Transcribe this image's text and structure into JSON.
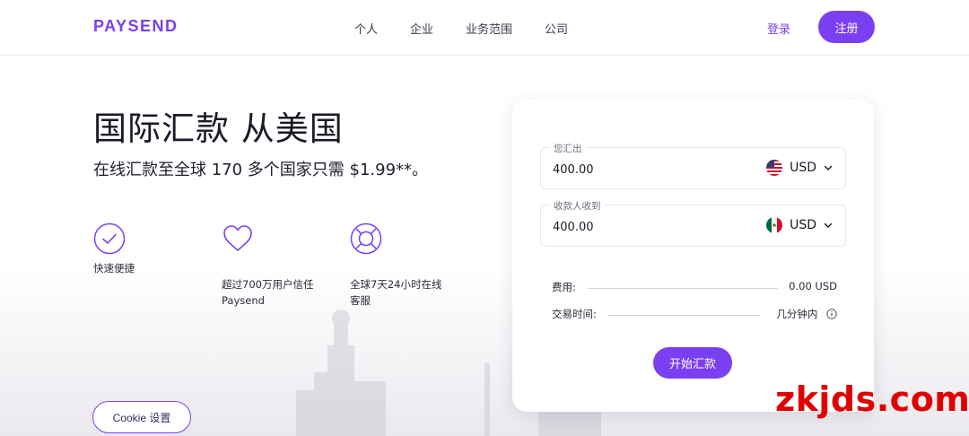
{
  "header": {
    "logo": "PAYSEND",
    "nav": [
      "个人",
      "企业",
      "业务范围",
      "公司"
    ],
    "login": "登录",
    "signup": "注册"
  },
  "hero": {
    "title": "国际汇款 从美国",
    "subtitle": "在线汇款至全球 170 多个国家只需 $1.99**。"
  },
  "features": [
    {
      "icon": "check-circle-icon",
      "text": "快速便捷"
    },
    {
      "icon": "heart-icon",
      "text": "超过700万用户信任\nPaysend"
    },
    {
      "icon": "lifebuoy-icon",
      "text": "全球7天24小时在线\n客服"
    }
  ],
  "cookie_button": "Cookie 设置",
  "calculator": {
    "send": {
      "label": "您汇出",
      "amount": "400.00",
      "currency": "USD",
      "flag": "us-flag-icon"
    },
    "receive": {
      "label": "收款人收到",
      "amount": "400.00",
      "currency": "USD",
      "flag": "mexico-flag-icon"
    },
    "fee": {
      "label": "费用:",
      "value": "0.00 USD"
    },
    "time": {
      "label": "交易时间:",
      "value": "几分钟内"
    },
    "submit": "开始汇款"
  },
  "watermark": "zkjds.com",
  "colors": {
    "accent": "#7b3ff2",
    "watermark": "#e10000"
  }
}
